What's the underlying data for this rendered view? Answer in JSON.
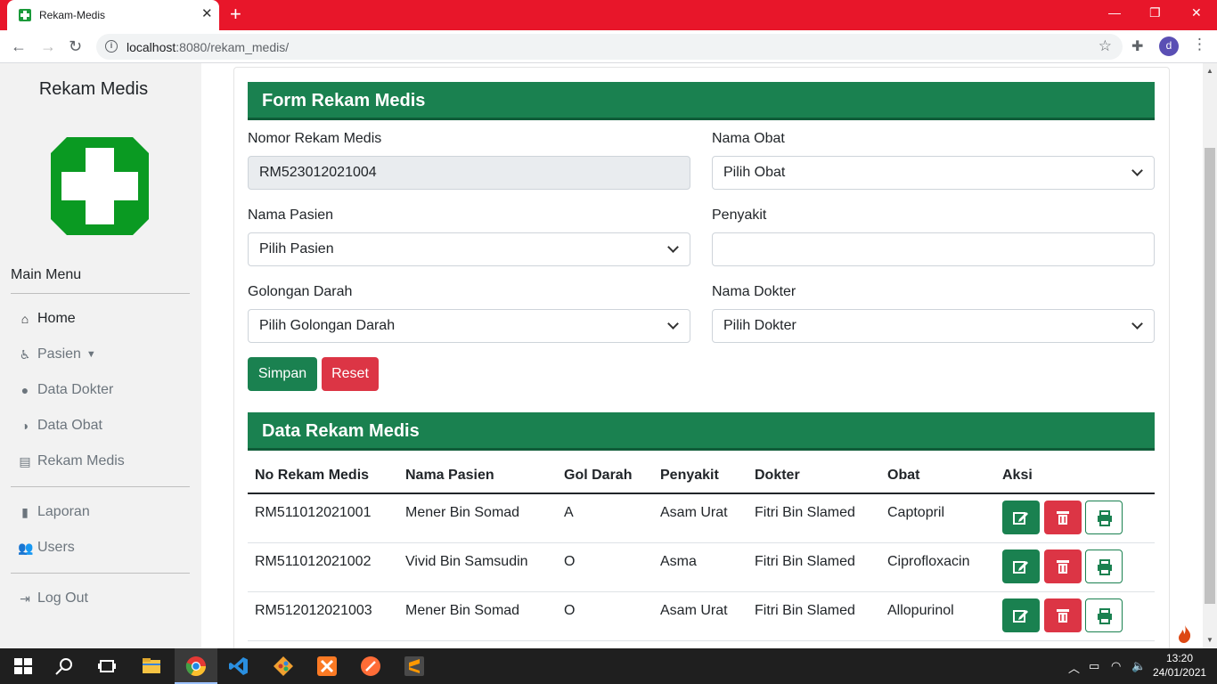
{
  "browser": {
    "tab_title": "Rekam-Medis",
    "url_host": "localhost",
    "url_rest": ":8080/rekam_medis/",
    "avatar_letter": "d"
  },
  "sidebar": {
    "title": "Rekam Medis",
    "main_menu_label": "Main Menu",
    "items": [
      {
        "label": "Home",
        "icon": "home-icon"
      },
      {
        "label": "Pasien",
        "icon": "user-injured-icon"
      },
      {
        "label": "Data Dokter",
        "icon": "user-doctor-icon"
      },
      {
        "label": "Data Obat",
        "icon": "pills-icon"
      },
      {
        "label": "Rekam Medis",
        "icon": "file-medical-icon"
      },
      {
        "label": "Laporan",
        "icon": "file-icon"
      },
      {
        "label": "Users",
        "icon": "users-icon"
      },
      {
        "label": "Log Out",
        "icon": "sign-out-icon"
      }
    ]
  },
  "form": {
    "title": "Form Rekam Medis",
    "nomor_label": "Nomor Rekam Medis",
    "nomor_value": "RM523012021004",
    "obat_label": "Nama Obat",
    "obat_value": "Pilih Obat",
    "pasien_label": "Nama Pasien",
    "pasien_value": "Pilih Pasien",
    "penyakit_label": "Penyakit",
    "penyakit_value": "",
    "goldar_label": "Golongan Darah",
    "goldar_value": "Pilih Golongan Darah",
    "dokter_label": "Nama Dokter",
    "dokter_value": "Pilih Dokter",
    "save_label": "Simpan",
    "reset_label": "Reset"
  },
  "table": {
    "title": "Data Rekam Medis",
    "headers": [
      "No Rekam Medis",
      "Nama Pasien",
      "Gol Darah",
      "Penyakit",
      "Dokter",
      "Obat",
      "Aksi"
    ],
    "rows": [
      [
        "RM511012021001",
        "Mener Bin Somad",
        "A",
        "Asam Urat",
        "Fitri Bin Slamed",
        "Captopril"
      ],
      [
        "RM511012021002",
        "Vivid Bin Samsudin",
        "O",
        "Asma",
        "Fitri Bin Slamed",
        "Ciprofloxacin"
      ],
      [
        "RM512012021003",
        "Mener Bin Somad",
        "O",
        "Asam Urat",
        "Fitri Bin Slamed",
        "Allopurinol"
      ]
    ]
  },
  "taskbar": {
    "time": "13:20",
    "date": "24/01/2021"
  },
  "colors": {
    "primary_green": "#1a8150",
    "danger_red": "#dc3545",
    "tab_bar_red": "#e8162a"
  }
}
